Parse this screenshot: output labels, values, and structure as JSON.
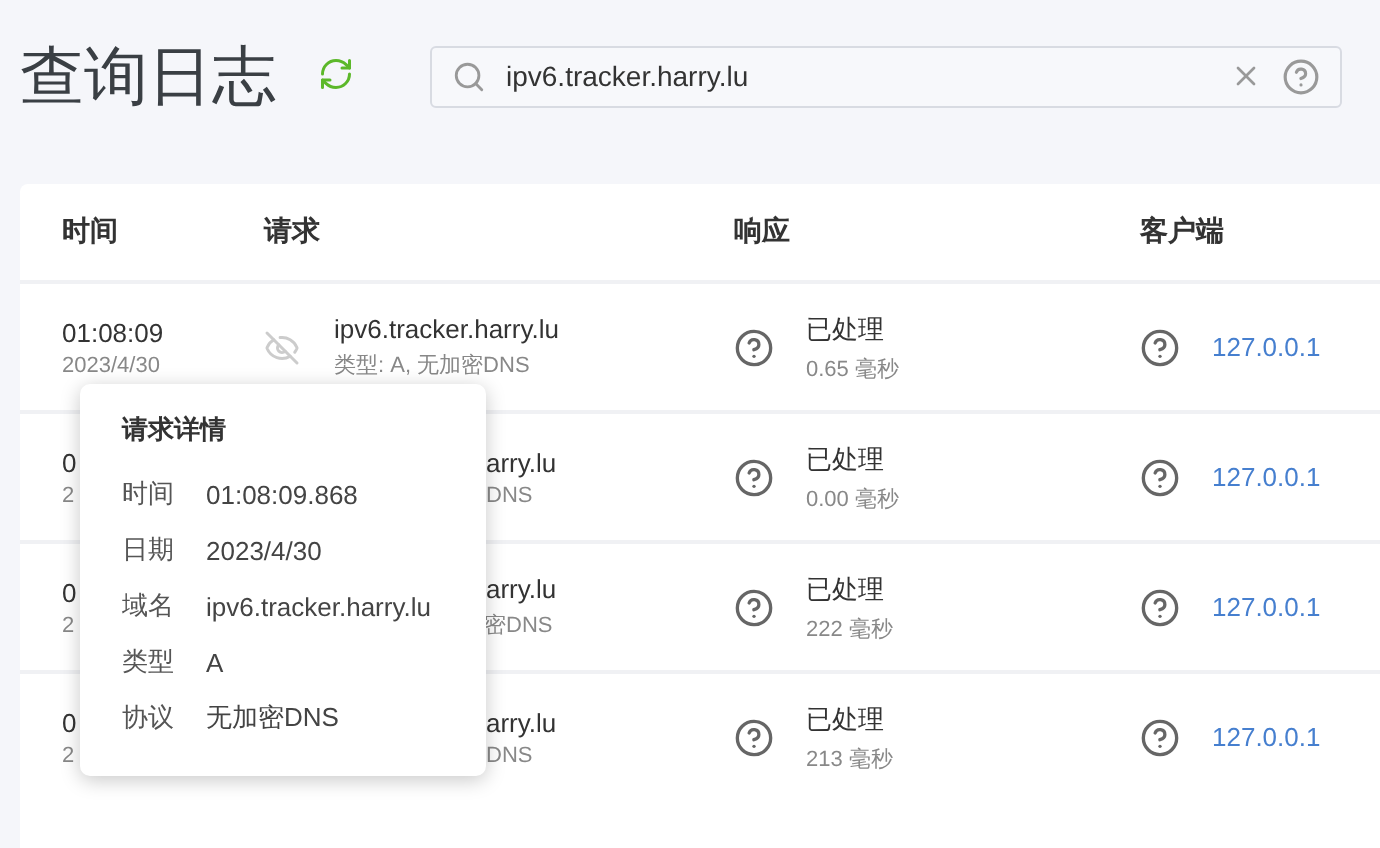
{
  "title": "查询日志",
  "search": {
    "value": "ipv6.tracker.harry.lu"
  },
  "columns": [
    "时间",
    "请求",
    "响应",
    "客户端"
  ],
  "rows": [
    {
      "kind": "full",
      "time": "01:08:09",
      "date": "2023/4/30",
      "domain": "ipv6.tracker.harry.lu",
      "detail": "类型: A, 无加密DNS",
      "status": "已处理",
      "elapsed": "0.65 毫秒",
      "client": "127.0.0.1"
    },
    {
      "kind": "covered",
      "time": "0",
      "date": "2",
      "domain": "arry.lu",
      "detail": "DNS",
      "status": "已处理",
      "elapsed": "0.00 毫秒",
      "client": "127.0.0.1"
    },
    {
      "kind": "covered",
      "time": "0",
      "date": "2",
      "domain": "arry.lu",
      "detail": "密DNS",
      "status": "已处理",
      "elapsed": "222 毫秒",
      "client": "127.0.0.1"
    },
    {
      "kind": "covered",
      "time": "0",
      "date": "2",
      "domain": "arry.lu",
      "detail": "DNS",
      "status": "已处理",
      "elapsed": "213 毫秒",
      "client": "127.0.0.1"
    }
  ],
  "popup": {
    "title": "请求详情",
    "fields": [
      {
        "label": "时间",
        "value": "01:08:09.868"
      },
      {
        "label": "日期",
        "value": "2023/4/30"
      },
      {
        "label": "域名",
        "value": "ipv6.tracker.harry.lu"
      },
      {
        "label": "类型",
        "value": "A"
      },
      {
        "label": "协议",
        "value": "无加密DNS"
      }
    ]
  }
}
